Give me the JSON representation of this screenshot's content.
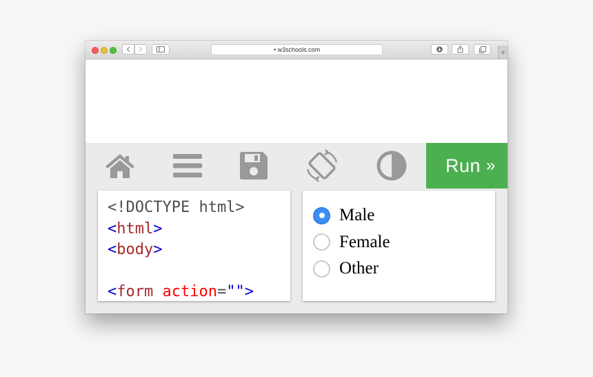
{
  "browser": {
    "url": "w3schools.com",
    "nav_back_icon": "chevron-left-icon",
    "nav_forward_icon": "chevron-right-icon",
    "new_tab_label": "+"
  },
  "toolbar": {
    "icons": [
      "home-icon",
      "menu-icon",
      "save-icon",
      "rotate-icon",
      "contrast-icon"
    ],
    "icon_color": "#999999",
    "run_label": "Run",
    "run_arrow": "»",
    "run_color": "#4caf50"
  },
  "code_lines": {
    "l1": "<!DOCTYPE html>",
    "l2_open": "<",
    "l2_tag": "html",
    "l2_close": ">",
    "l3_open": "<",
    "l3_tag": "body",
    "l3_close": ">",
    "l5_open": "<",
    "l5_tag": "form",
    "l5_attr": "action",
    "l5_eq": "=",
    "l5_val": "\"\"",
    "l5_close": ">"
  },
  "result": {
    "options": [
      {
        "label": "Male",
        "checked": true
      },
      {
        "label": "Female",
        "checked": false
      },
      {
        "label": "Other",
        "checked": false
      }
    ]
  }
}
